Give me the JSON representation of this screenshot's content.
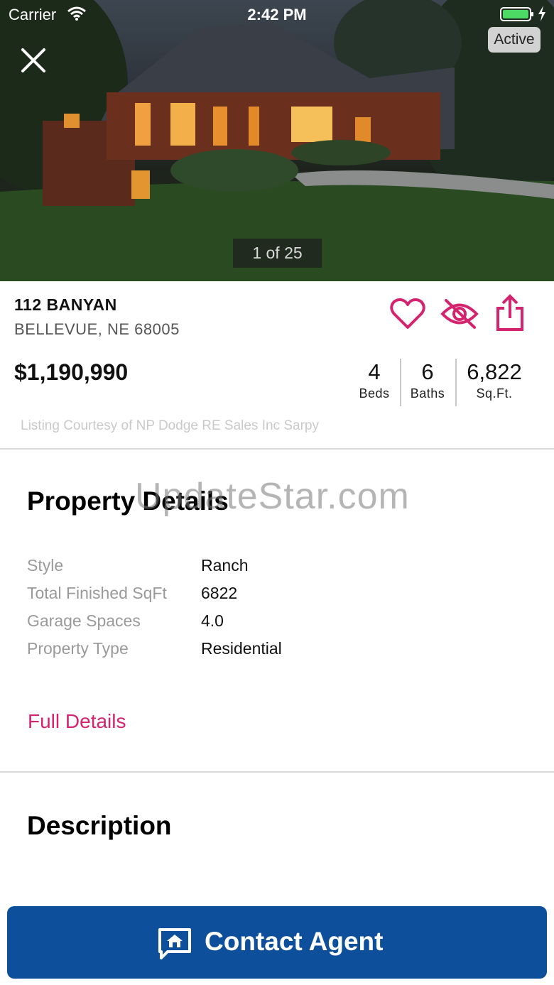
{
  "status_bar": {
    "carrier": "Carrier",
    "time": "2:42 PM"
  },
  "hero": {
    "status_badge": "Active",
    "photo_counter": "1 of 25"
  },
  "listing": {
    "street": "112 BANYAN",
    "city": "BELLEVUE, NE 68005",
    "price": "$1,190,990",
    "stats": {
      "beds_value": "4",
      "beds_label": "Beds",
      "baths_value": "6",
      "baths_label": "Baths",
      "sqft_value": "6,822",
      "sqft_label": "Sq.Ft."
    },
    "courtesy": "Listing Courtesy of NP Dodge RE Sales Inc Sarpy"
  },
  "property_details": {
    "title": "Property Details",
    "watermark": "UpdateStar.com",
    "rows": [
      {
        "key": "Style",
        "value": "Ranch"
      },
      {
        "key": "Total Finished SqFt",
        "value": "6822"
      },
      {
        "key": "Garage Spaces",
        "value": "4.0"
      },
      {
        "key": "Property Type",
        "value": "Residential"
      }
    ],
    "full_details_link": "Full Details"
  },
  "description": {
    "title": "Description"
  },
  "contact": {
    "label": "Contact Agent"
  },
  "colors": {
    "accent_pink": "#d4236f",
    "contact_blue": "#0d4f9b",
    "battery_green": "#4cd964"
  },
  "icons": {
    "close": "close-icon",
    "favorite": "heart-icon",
    "hide": "eye-off-icon",
    "share": "share-icon",
    "contact": "message-home-icon"
  }
}
